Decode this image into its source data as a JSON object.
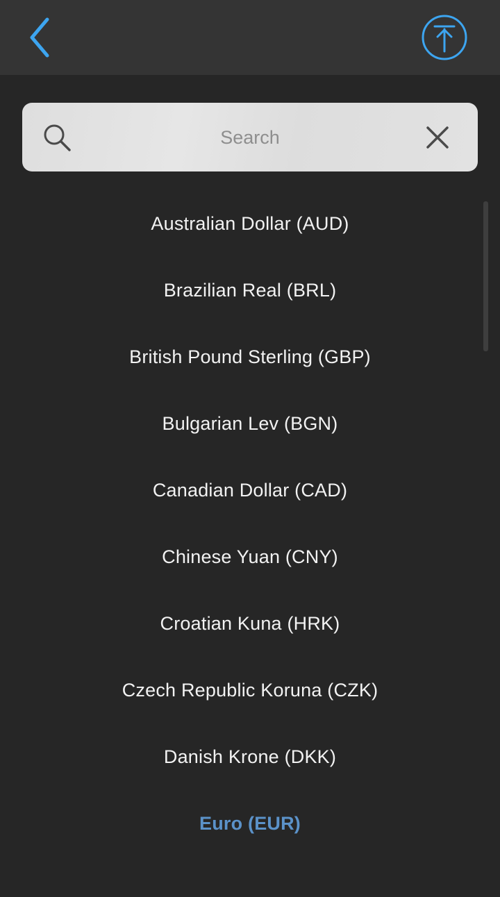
{
  "header": {
    "back_icon": "chevron-left-icon",
    "scroll_top_icon": "arrow-up-to-top-circle-icon",
    "accent_color": "#3da5f0"
  },
  "search": {
    "placeholder": "Search",
    "value": "",
    "search_icon": "magnifier-icon",
    "clear_icon": "close-icon"
  },
  "currencies": [
    {
      "label": "Australian Dollar (AUD)",
      "selected": false
    },
    {
      "label": "Brazilian Real (BRL)",
      "selected": false
    },
    {
      "label": "British Pound Sterling (GBP)",
      "selected": false
    },
    {
      "label": "Bulgarian Lev (BGN)",
      "selected": false
    },
    {
      "label": "Canadian Dollar (CAD)",
      "selected": false
    },
    {
      "label": "Chinese Yuan (CNY)",
      "selected": false
    },
    {
      "label": "Croatian Kuna (HRK)",
      "selected": false
    },
    {
      "label": "Czech Republic Koruna (CZK)",
      "selected": false
    },
    {
      "label": "Danish Krone (DKK)",
      "selected": false
    },
    {
      "label": "Euro (EUR)",
      "selected": true
    }
  ],
  "colors": {
    "background": "#262626",
    "top_bar": "#343434",
    "item_text": "#f2f2f2",
    "selected_text": "#5b92c9"
  }
}
